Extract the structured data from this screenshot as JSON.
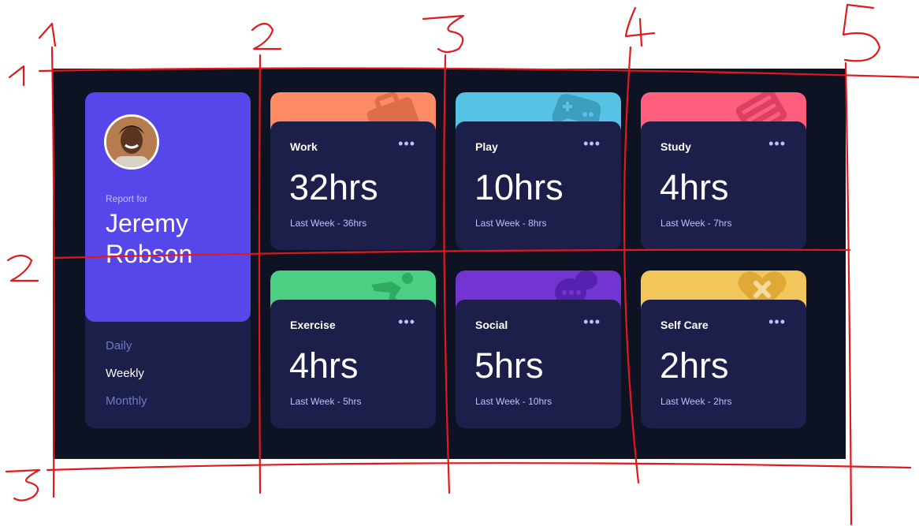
{
  "profile": {
    "report_for": "Report for",
    "name": "Jeremy Robson",
    "periods": [
      "Daily",
      "Weekly",
      "Monthly"
    ],
    "active_period": "Weekly"
  },
  "cards": [
    {
      "title": "Work",
      "current": "32hrs",
      "previous": "Last Week - 36hrs",
      "color": "#ff8b64",
      "icon": "briefcase-icon",
      "menu": "•••"
    },
    {
      "title": "Play",
      "current": "10hrs",
      "previous": "Last Week - 8hrs",
      "color": "#55c2e6",
      "icon": "gamepad-icon",
      "menu": "•••"
    },
    {
      "title": "Study",
      "current": "4hrs",
      "previous": "Last Week - 7hrs",
      "color": "#ff5e7d",
      "icon": "book-icon",
      "menu": "•••"
    },
    {
      "title": "Exercise",
      "current": "4hrs",
      "previous": "Last Week - 5hrs",
      "color": "#4bcf83",
      "icon": "runner-icon",
      "menu": "•••"
    },
    {
      "title": "Social",
      "current": "5hrs",
      "previous": "Last Week - 10hrs",
      "color": "#7235d1",
      "icon": "chat-bubble-icon",
      "menu": "•••"
    },
    {
      "title": "Self Care",
      "current": "2hrs",
      "previous": "Last Week - 2hrs",
      "color": "#f1c75b",
      "icon": "heart-cross-icon",
      "menu": "•••"
    }
  ],
  "annotations": {
    "column_numbers": [
      "1",
      "2",
      "3",
      "4",
      "5"
    ],
    "row_numbers": [
      "1",
      "2",
      "3"
    ],
    "line_color": "#e0191f"
  }
}
